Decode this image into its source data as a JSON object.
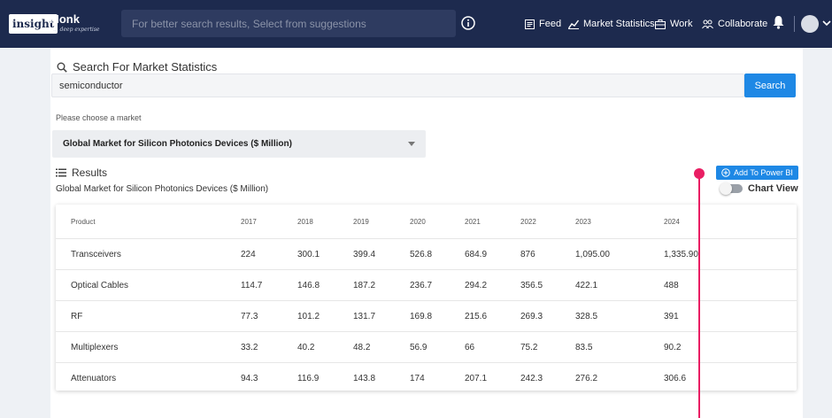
{
  "nav": {
    "logo_text": "insight",
    "logo_monk": "Monk",
    "logo_tagline": "... deep expertise",
    "search_placeholder": "For better search results, Select from suggestions",
    "items": [
      {
        "label": "Feed",
        "icon": "feed-icon"
      },
      {
        "label": "Market Statistics",
        "icon": "chart-icon"
      },
      {
        "label": "Work",
        "icon": "briefcase-icon"
      },
      {
        "label": "Collaborate",
        "icon": "collaborate-icon"
      }
    ]
  },
  "main": {
    "search_title": "Search For Market Statistics",
    "search_value": "semiconductor",
    "search_button": "Search",
    "choose_label": "Please choose a market",
    "selected_market": "Global Market for Silicon Photonics Devices ($ Million)",
    "results_title": "Results",
    "results_subtitle": "Global Market for Silicon Photonics Devices ($ Million)",
    "powerbi_button": "Add To Power BI",
    "chart_view_label": "Chart View"
  },
  "table": {
    "headers": [
      "Product",
      "2017",
      "2018",
      "2019",
      "2020",
      "2021",
      "2022",
      "2023",
      "2024"
    ],
    "rows": [
      [
        "Transceivers",
        "224",
        "300.1",
        "399.4",
        "526.8",
        "684.9",
        "876",
        "1,095.00",
        "1,335.90"
      ],
      [
        "Optical Cables",
        "114.7",
        "146.8",
        "187.2",
        "236.7",
        "294.2",
        "356.5",
        "422.1",
        "488"
      ],
      [
        "RF",
        "77.3",
        "101.2",
        "131.7",
        "169.8",
        "215.6",
        "269.3",
        "328.5",
        "391"
      ],
      [
        "Multiplexers",
        "33.2",
        "40.2",
        "48.2",
        "56.9",
        "66",
        "75.2",
        "83.5",
        "90.2"
      ],
      [
        "Attenuators",
        "94.3",
        "116.9",
        "143.8",
        "174",
        "207.1",
        "242.3",
        "276.2",
        "306.6"
      ]
    ]
  },
  "colors": {
    "navbar": "#1d2a4e",
    "accent": "#1e88e5",
    "marker": "#e91e63"
  }
}
